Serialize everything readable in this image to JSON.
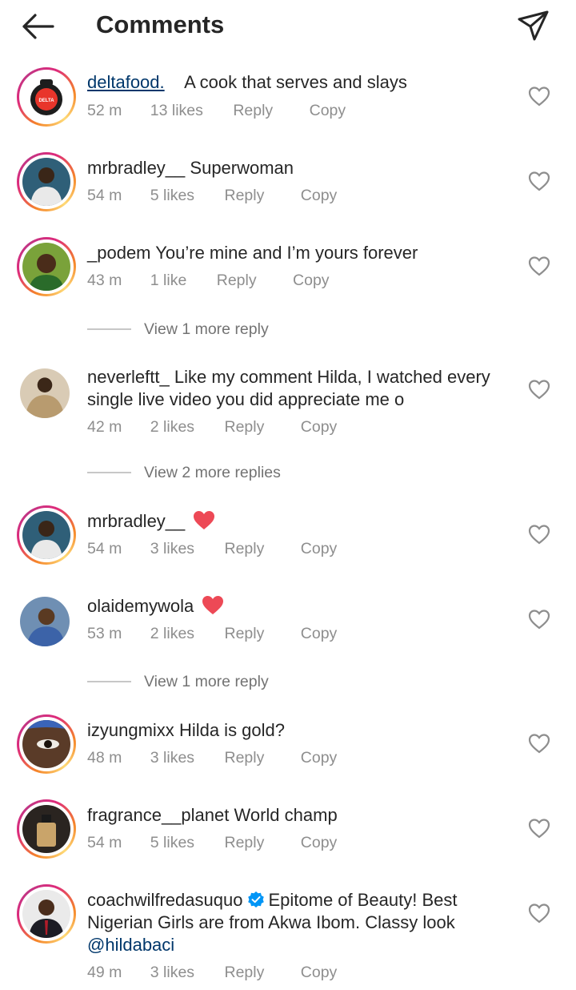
{
  "header": {
    "title": "Comments"
  },
  "comments": [
    {
      "username": "deltafood.",
      "text": "A cook that serves and slays",
      "time": "52 m",
      "likes": "13 likes",
      "reply": "Reply",
      "copy": "Copy"
    },
    {
      "username": "mrbradley__",
      "text": "Superwoman",
      "time": "54 m",
      "likes": "5 likes",
      "reply": "Reply",
      "copy": "Copy"
    },
    {
      "username": "_podem",
      "text": "You’re mine and I’m yours forever",
      "time": "43 m",
      "likes": "1 like",
      "reply": "Reply",
      "copy": "Copy",
      "view_more": "View 1 more reply"
    },
    {
      "username": "neverleftt_",
      "text": "Like my comment Hilda, I watched every single live video you did appreciate me o",
      "time": "42 m",
      "likes": "2 likes",
      "reply": "Reply",
      "copy": "Copy",
      "view_more": "View 2 more replies"
    },
    {
      "username": "mrbradley__",
      "text": "",
      "time": "54 m",
      "likes": "3 likes",
      "reply": "Reply",
      "copy": "Copy"
    },
    {
      "username": "olaidemywola",
      "text": "",
      "time": "53 m",
      "likes": "2 likes",
      "reply": "Reply",
      "copy": "Copy",
      "view_more": "View 1 more reply"
    },
    {
      "username": "izyungmixx",
      "text": "Hilda is gold?",
      "time": "48 m",
      "likes": "3 likes",
      "reply": "Reply",
      "copy": "Copy"
    },
    {
      "username": "fragrance__planet",
      "text": "World champ",
      "time": "54 m",
      "likes": "5 likes",
      "reply": "Reply",
      "copy": "Copy"
    },
    {
      "username": "coachwilfredasuquo",
      "text": "Epitome of Beauty! Best Nigerian Girls are from Akwa Ibom. Classy look",
      "mention": "@hildabaci",
      "time": "49 m",
      "likes": "3 likes",
      "reply": "Reply",
      "copy": "Copy"
    }
  ],
  "icons": {
    "back": "arrow-left-icon",
    "send": "paper-plane-icon",
    "like": "heart-outline-icon",
    "verified": "verified-badge-icon",
    "emoji": "red-heart-emoji"
  },
  "colors": {
    "text": "#262626",
    "muted": "#8e8e8e",
    "link": "#00376b",
    "verified": "#0095f6",
    "heart": "#ed4956"
  }
}
